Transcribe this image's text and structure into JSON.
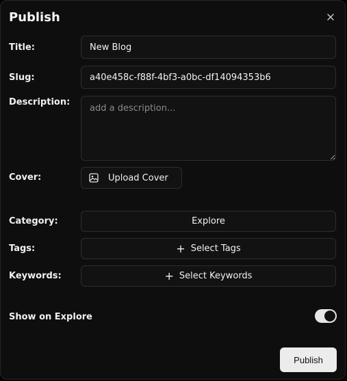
{
  "dialog": {
    "title": "Publish",
    "close_icon": "close-icon"
  },
  "form": {
    "title_label": "Title:",
    "title_value": "New Blog",
    "slug_label": "Slug:",
    "slug_value": "a40e458c-f88f-4bf3-a0bc-df14094353b6",
    "description_label": "Description:",
    "description_placeholder": "add a description...",
    "cover_label": "Cover:",
    "upload_cover_label": "Upload Cover",
    "upload_icon": "image-icon",
    "category_label": "Category:",
    "category_value": "Explore",
    "tags_label": "Tags:",
    "select_tags_label": "Select Tags",
    "keywords_label": "Keywords:",
    "select_keywords_label": "Select Keywords",
    "plus_symbol": "+",
    "show_on_explore_label": "Show on Explore",
    "show_on_explore_enabled": true
  },
  "footer": {
    "publish_label": "Publish"
  },
  "colors": {
    "background": "#0e0e0e",
    "field": "#121212",
    "border": "#2e2e2e",
    "text": "#f2f2f2",
    "button_light": "#ececec"
  }
}
